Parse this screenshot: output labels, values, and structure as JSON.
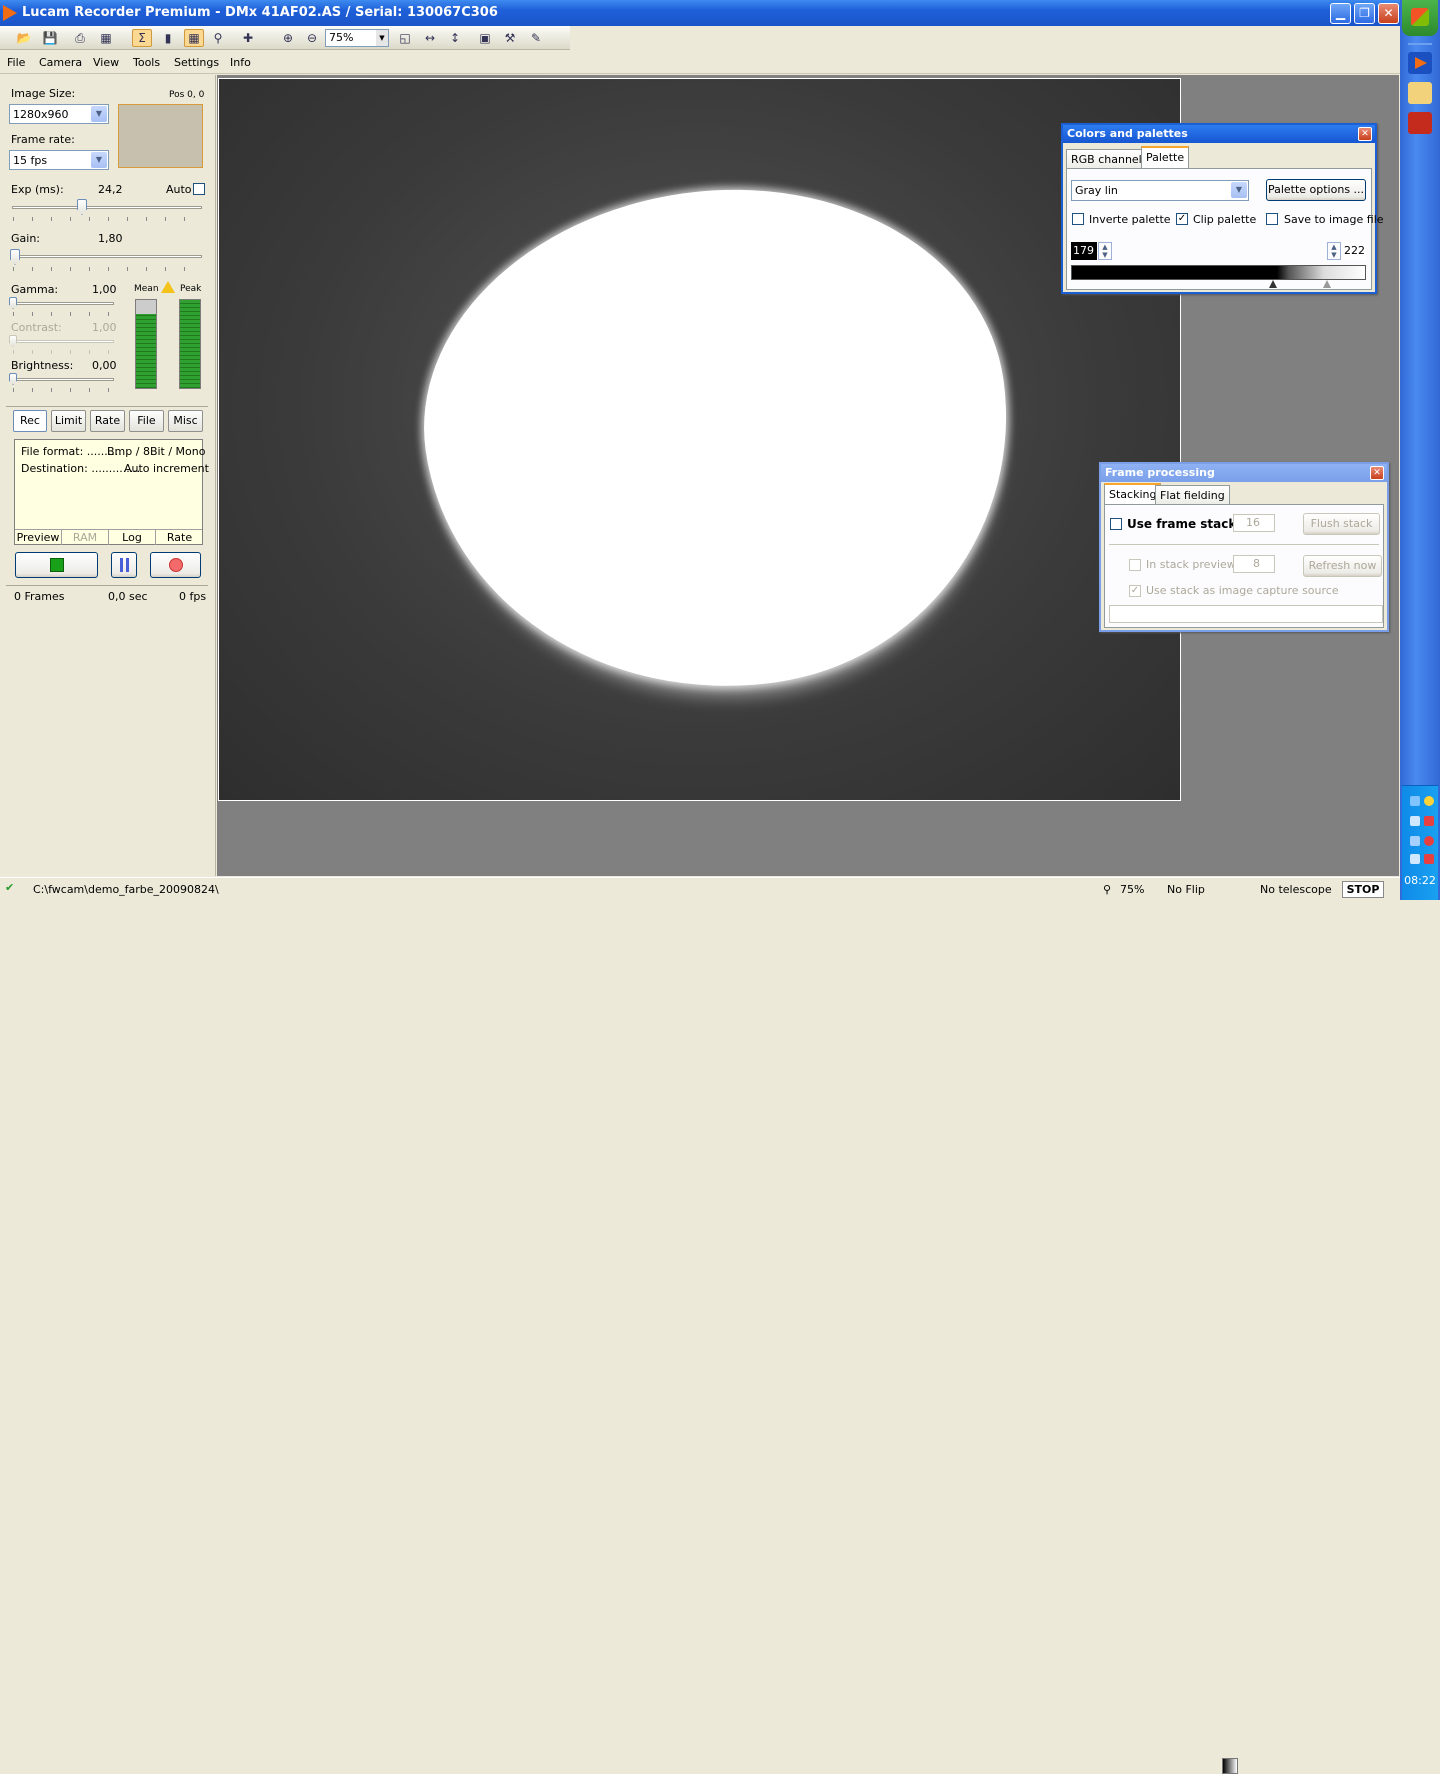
{
  "window": {
    "title": "Lucam Recorder Premium - DMx 41AF02.AS / Serial: 130067C306",
    "min": "▁",
    "max": "❐",
    "close": "✕"
  },
  "toolbar": {
    "zoom": "75%"
  },
  "menu": [
    "File",
    "Camera",
    "View",
    "Tools",
    "Settings",
    "Info"
  ],
  "left": {
    "image_size_label": "Image Size:",
    "image_size_value": "1280x960",
    "pos_label": "Pos 0, 0",
    "frame_rate_label": "Frame rate:",
    "frame_rate_value": "15 fps",
    "exp_label": "Exp (ms):",
    "exp_value": "24,2",
    "auto_label": "Auto",
    "gain_label": "Gain:",
    "gain_value": "1,80",
    "gamma_label": "Gamma:",
    "gamma_value": "1,00",
    "contrast_label": "Contrast:",
    "contrast_value": "1,00",
    "brightness_label": "Brightness:",
    "brightness_value": "0,00",
    "mean_label": "Mean",
    "peak_label": "Peak",
    "tabs": [
      "Rec",
      "Limit",
      "Rate",
      "File",
      "Misc"
    ],
    "file_format_label": "File format: ..........",
    "file_format_value": "Bmp / 8Bit / Mono",
    "destination_label": "Destination: ..............",
    "destination_value": "Auto increment",
    "subtabs": [
      "Preview",
      "RAM",
      "Log",
      "Rate"
    ],
    "frames": "0 Frames",
    "sec": "0,0 sec",
    "fps": "0 fps"
  },
  "colors_panel": {
    "title": "Colors and palettes",
    "tabs": [
      "RGB channels",
      "Palette"
    ],
    "palette_value": "Gray lin",
    "palette_options": "Palette options ...",
    "inverte": "Inverte palette",
    "clip": "Clip palette",
    "save": "Save to image file",
    "low": "179",
    "high": "222"
  },
  "frame_panel": {
    "title": "Frame processing",
    "tabs": [
      "Stacking",
      "Flat fielding"
    ],
    "use_stack": "Use frame stack",
    "stack_count": "16",
    "flush": "Flush stack",
    "in_stack_preview": "In stack preview",
    "preview_count": "8",
    "refresh": "Refresh now",
    "use_stack_source": "Use stack as image capture source"
  },
  "status": {
    "path": "C:\\fwcam\\demo_farbe_20090824\\",
    "zoom": "75%",
    "flip": "No Flip",
    "telescope": "No telescope",
    "stop": "STOP"
  },
  "taskbar": {
    "clock": "08:22"
  }
}
